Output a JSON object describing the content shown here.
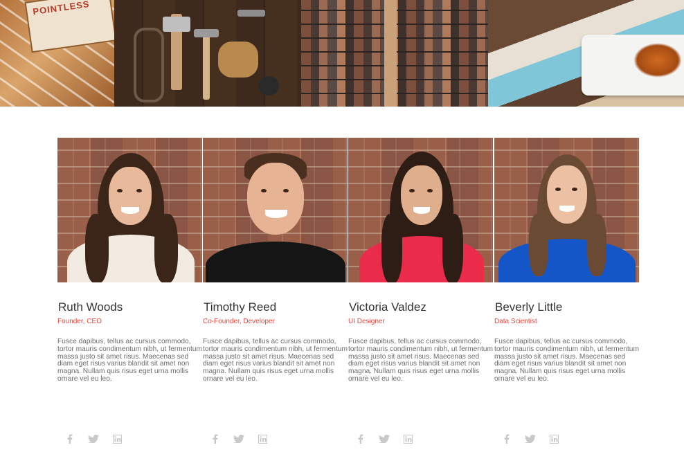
{
  "gallery": {
    "tiles": [
      {
        "icon": "pencils-photo",
        "sign_text": "POINTLESS"
      },
      {
        "icon": "tools-photo"
      },
      {
        "icon": "letterpress-type-photo"
      },
      {
        "icon": "plate-food-photo"
      }
    ]
  },
  "team": {
    "members": [
      {
        "name": "Ruth Woods",
        "role": "Founder, CEO",
        "bio": "Fusce dapibus, tellus ac cursus commodo, tortor mauris condimentum nibh, ut fermentum massa justo sit amet risus. Maecenas sed diam eget risus varius blandit sit amet non magna. Nullam quis risus eget urna mollis ornare vel eu leo."
      },
      {
        "name": "Timothy Reed",
        "role": "Co-Founder, Developer",
        "bio": "Fusce dapibus, tellus ac cursus commodo, tortor mauris condimentum nibh, ut fermentum massa justo sit amet risus. Maecenas sed diam eget risus varius blandit sit amet non magna. Nullam quis risus eget urna mollis ornare vel eu leo."
      },
      {
        "name": "Victoria Valdez",
        "role": "UI Designer",
        "bio": "Fusce dapibus, tellus ac cursus commodo, tortor mauris condimentum nibh, ut fermentum massa justo sit amet risus. Maecenas sed diam eget risus varius blandit sit amet non magna. Nullam quis risus eget urna mollis ornare vel eu leo."
      },
      {
        "name": "Beverly Little",
        "role": "Data Scientist",
        "bio": "Fusce dapibus, tellus ac cursus commodo, tortor mauris condimentum nibh, ut fermentum massa justo sit amet risus. Maecenas sed diam eget risus varius blandit sit amet non magna. Nullam quis risus eget urna mollis ornare vel eu leo."
      }
    ],
    "social_icons": [
      "facebook-icon",
      "twitter-icon",
      "linkedin-icon"
    ]
  },
  "colors": {
    "role_accent": "#e2463e",
    "name_text": "#333333",
    "bio_text": "#6c6c6c",
    "social_icon": "#c9c9c9"
  }
}
